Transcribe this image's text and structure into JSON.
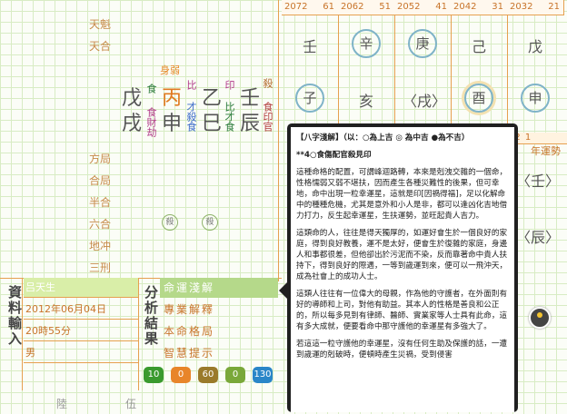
{
  "left_labels_top": [
    "天魁",
    "天合"
  ],
  "left_labels_mid": [
    "方局",
    "合局",
    "半合",
    "六合",
    "地冲",
    "三刑"
  ],
  "body_weak": "身弱",
  "pillars": [
    {
      "stem": "戊",
      "branch": "戌",
      "god1": "食",
      "god2": "食財劫"
    },
    {
      "stem": "丙",
      "branch": "申",
      "god1": "比",
      "god2": "才殺食"
    },
    {
      "stem": "乙",
      "branch": "巳",
      "god1": "印",
      "god2": "比才食"
    },
    {
      "stem": "壬",
      "branch": "辰",
      "god1": "殺",
      "god2": "食印官"
    }
  ],
  "sha_marks": [
    "殺",
    "殺"
  ],
  "dayun_top": [
    {
      "year": "2072",
      "age": "61"
    },
    {
      "year": "2062",
      "age": "51"
    },
    {
      "year": "2052",
      "age": "41"
    },
    {
      "year": "2042",
      "age": "31"
    },
    {
      "year": "2032",
      "age": "21"
    }
  ],
  "dayun_stems": [
    "壬",
    "辛",
    "庚",
    "己",
    "戊"
  ],
  "dayun_branches": [
    "子",
    "亥",
    "〈戌〉",
    "酉",
    "申"
  ],
  "dayun_partial": {
    "row": "12",
    "age": "1",
    "label": "年運勢",
    "stem": "〈壬〉",
    "branch": "〈辰〉"
  },
  "input_panel": {
    "title": "資料輸入",
    "name": "吕天生",
    "date": "2012年06月04日",
    "time": "20時55分",
    "gender": "男"
  },
  "analysis": {
    "title": "分析結果",
    "menu": [
      "命運淺解",
      "專業解釋",
      "本命格局",
      "智慧提示"
    ]
  },
  "scores": [
    {
      "value": "10",
      "color": "#3a9a2e"
    },
    {
      "value": "0",
      "color": "#e8852a"
    },
    {
      "value": "60",
      "color": "#9a7a2a"
    },
    {
      "value": "0",
      "color": "#7aa83a"
    },
    {
      "value": "130",
      "color": "#2a86c8"
    }
  ],
  "bottom_labels": [
    "陸",
    "伍"
  ],
  "popup": {
    "header": "【八字淺解】（以：○為上吉 ◎ 為中吉 ●為不吉）",
    "subtitle": "**4○食傷配官殺見印",
    "p1": "這種命格的配置，可謂峰迴路轉，本來是剋洩交雜的一個命，性格懦弱又弱不堪扶，因而產生各種災難性的後果，但可幸地，命中出現一粒幸運星，這就是印[因禍得福]，足以化解命中的種種危機，尤其是意外和小人是非，都可以逢凶化吉地借力打力，反生起幸運星，生扶運勢，並旺起貴人吉力。",
    "p2": "這類命的人，往往是得天獨厚的，如運好會生於一個良好的家庭，得到良好教養，運不是太好，便會生於復雜的家庭，身邊人和事都很差，但他卻出於污泥而不染，反而靠著命中貴人扶持下，得到良好的際遇，一等到歲運到來，便可以一飛沖天，成為社會上的成功人士。",
    "p3": "這類人往往有一位偉大的母親，作為他的守護者，在外面則有好的導師和上司，對他有助益。其本人的性格是善良和公正的，所以每多見到有律師、醫師、實業家等人士具有此命，這有多大成就，便要看命中那守護他的幸運星有多強大了。",
    "p4": "若這這一粒守護他的幸運星，沒有任何生助及保護的話，一遭到歲運的剋破時，便頓時產生災禍，受到侵害"
  }
}
